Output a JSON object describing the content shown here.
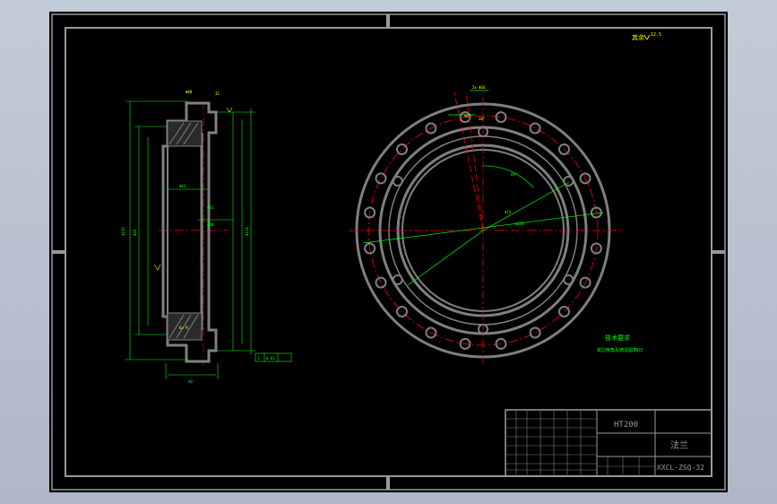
{
  "colors": {
    "background": "#000000",
    "frame": "#9a9a9a",
    "part": "#7f7f7f",
    "dimension": "#00ff00",
    "centerline": "#ff0000",
    "annotation": "#ffff00"
  },
  "drawing": {
    "surface_finish_general": "其余",
    "surface_finish_general_value": "12.5",
    "bolt_circle_diameter": "Φ18",
    "tech_requirements_title": "技术要求",
    "tech_requirements_line": "锐边倒角及铸造圆角R3"
  },
  "title_block": {
    "material": "HT200",
    "part_name": "法兰",
    "drawing_number": "XXCL-ZSQ-32"
  }
}
